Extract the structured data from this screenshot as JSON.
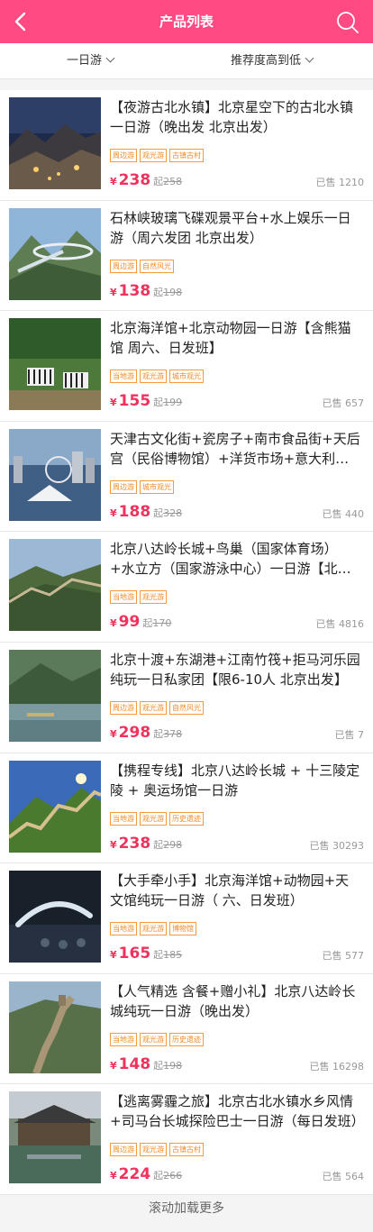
{
  "header": {
    "title": "产品列表",
    "back_icon": "back-arrow-icon",
    "search_icon": "search-icon",
    "bg_color": "#ff4a84"
  },
  "filters": {
    "category": "一日游",
    "sort": "推荐度高到低"
  },
  "products": [
    {
      "name": "【夜游古北水镇】北京星空下的古北水镇一日游（晚出发 北京出发）",
      "tags": [
        "周边游",
        "观光游",
        "古镇古村"
      ],
      "price": "238",
      "from_label": "起",
      "original": "258",
      "sold": "已售 1210"
    },
    {
      "name": "石林峡玻璃飞碟观景平台+水上娱乐一日游（周六发团 北京出发）",
      "tags": [
        "周边游",
        "自然风光"
      ],
      "price": "138",
      "from_label": "起",
      "original": "198",
      "sold": ""
    },
    {
      "name": "北京海洋馆+北京动物园一日游【含熊猫馆 周六、日发班】",
      "tags": [
        "当地游",
        "观光游",
        "城市观光"
      ],
      "price": "155",
      "from_label": "起",
      "original": "199",
      "sold": "已售 657"
    },
    {
      "name": "天津古文化街+瓷房子+南市食品街+天后宫（民俗博物馆）+洋货市场+意大利风情区",
      "tags": [
        "周边游",
        "城市观光"
      ],
      "price": "188",
      "from_label": "起",
      "original": "328",
      "sold": "已售 440"
    },
    {
      "name": "北京八达岭长城+鸟巢（国家体育场）+水立方（国家游泳中心）一日游【北京出发】",
      "tags": [
        "当地游",
        "观光游"
      ],
      "price": "99",
      "from_label": "起",
      "original": "170",
      "sold": "已售 4816"
    },
    {
      "name": "北京十渡+东湖港+江南竹筏+拒马河乐园纯玩一日私家团【限6-10人 北京出发】",
      "tags": [
        "周边游",
        "观光游",
        "自然风光"
      ],
      "price": "298",
      "from_label": "起",
      "original": "378",
      "sold": "已售 7"
    },
    {
      "name": "【携程专线】北京八达岭长城 + 十三陵定陵 + 奥运场馆一日游",
      "tags": [
        "当地游",
        "观光游",
        "历史遗迹"
      ],
      "price": "238",
      "from_label": "起",
      "original": "298",
      "sold": "已售 30293"
    },
    {
      "name": "【大手牵小手】北京海洋馆+动物园+天文馆纯玩一日游（ 六、日发班）",
      "tags": [
        "当地游",
        "观光游",
        "博物馆"
      ],
      "price": "165",
      "from_label": "起",
      "original": "185",
      "sold": "已售 577"
    },
    {
      "name": "【人气精选 含餐+赠小礼】北京八达岭长城纯玩一日游（晚出发）",
      "tags": [
        "当地游",
        "观光游",
        "历史遗迹"
      ],
      "price": "148",
      "from_label": "起",
      "original": "198",
      "sold": "已售 16298"
    },
    {
      "name": "【逃离雾霾之旅】北京古北水镇水乡风情+司马台长城探险巴士一日游（每日发班）",
      "tags": [
        "周边游",
        "观光游",
        "古镇古村"
      ],
      "price": "224",
      "from_label": "起",
      "original": "266",
      "sold": "已售 564"
    }
  ],
  "currency": "¥",
  "load_more": "滚动加载更多",
  "colors": {
    "accent": "#ff4a84",
    "price": "#f0325d",
    "tag": "#f08a26"
  }
}
